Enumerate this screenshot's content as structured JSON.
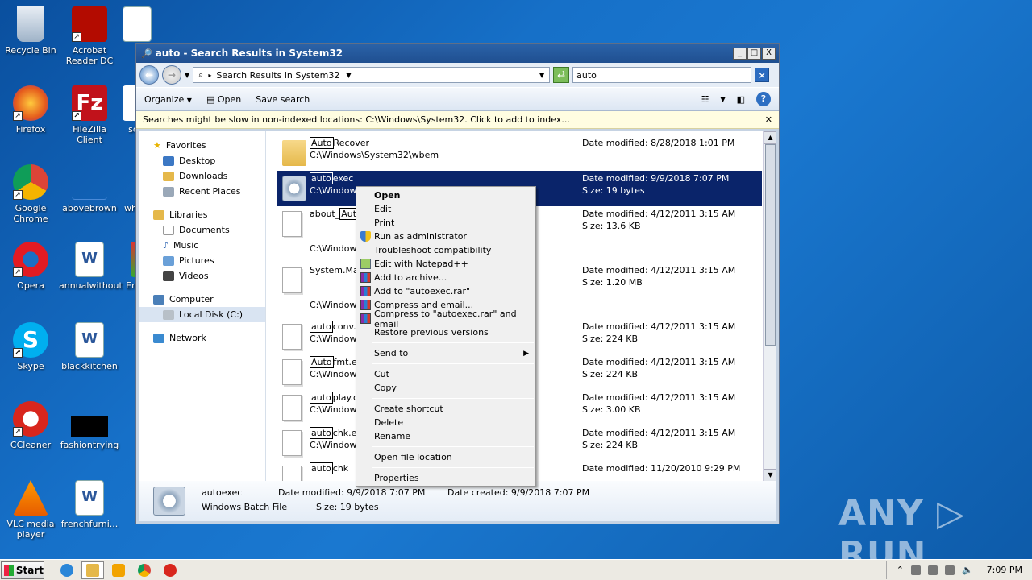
{
  "desktop": {
    "icons": [
      {
        "label": "Recycle Bin"
      },
      {
        "label": "Acrobat Reader DC"
      },
      {
        "label": "Firefox"
      },
      {
        "label": "FileZilla Client"
      },
      {
        "label": "Google Chrome"
      },
      {
        "label": "abovebrown"
      },
      {
        "label": "Opera"
      },
      {
        "label": "annualwithout"
      },
      {
        "label": "Skype"
      },
      {
        "label": "blackkitchen"
      },
      {
        "label": "CCleaner"
      },
      {
        "label": "fashiontrying"
      },
      {
        "label": "VLC media player"
      },
      {
        "label": "frenchfurni..."
      }
    ],
    "partial_labels": [
      "s",
      "sc",
      "wh",
      "Em"
    ]
  },
  "window": {
    "title": "auto - Search Results in System32",
    "controls": {
      "minimize": "_",
      "maximize": "□",
      "close": "X"
    },
    "address": "Search Results in System32",
    "search_value": "auto",
    "toolbar": {
      "organize": "Organize",
      "open": "Open",
      "save_search": "Save search"
    },
    "infobar": "Searches might be slow in non-indexed locations: C:\\Windows\\System32. Click to add to index...",
    "nav": {
      "favorites": "Favorites",
      "desktop": "Desktop",
      "downloads": "Downloads",
      "recent": "Recent Places",
      "libraries": "Libraries",
      "documents": "Documents",
      "music": "Music",
      "pictures": "Pictures",
      "videos": "Videos",
      "computer": "Computer",
      "local_disk": "Local Disk (C:)",
      "network": "Network"
    },
    "results": [
      {
        "pre": "",
        "hl": "Auto",
        "post": "Recover",
        "path": "C:\\Windows\\System32\\wbem",
        "date": "Date modified: 8/28/2018 1:01 PM",
        "size": ""
      },
      {
        "pre": "",
        "hl": "auto",
        "post": "exec",
        "path": "C:\\Window",
        "date": "Date modified: 9/9/2018 7:07 PM",
        "size": "Size: 19 bytes"
      },
      {
        "pre": "about_",
        "hl": "Auto",
        "post": "",
        "path": "C:\\Window",
        "date": "Date modified: 4/12/2011 3:15 AM",
        "size": "Size: 13.6 KB"
      },
      {
        "pre": "System.Ma",
        "hl": "",
        "post": "",
        "path": "C:\\Window",
        "date": "Date modified: 4/12/2011 3:15 AM",
        "size": "Size: 1.20 MB"
      },
      {
        "pre": "",
        "hl": "auto",
        "post": "conv.e",
        "path": "C:\\Window",
        "date": "Date modified: 4/12/2011 3:15 AM",
        "size": "Size: 224 KB"
      },
      {
        "pre": "",
        "hl": "Auto",
        "post": "fmt.ex",
        "path": "C:\\Window",
        "date": "Date modified: 4/12/2011 3:15 AM",
        "size": "Size: 224 KB"
      },
      {
        "pre": "",
        "hl": "auto",
        "post": "play.d",
        "path": "C:\\Window",
        "date": "Date modified: 4/12/2011 3:15 AM",
        "size": "Size: 3.00 KB"
      },
      {
        "pre": "",
        "hl": "auto",
        "post": "chk.ex",
        "path": "C:\\Window",
        "date": "Date modified: 4/12/2011 3:15 AM",
        "size": "Size: 224 KB"
      },
      {
        "pre": "",
        "hl": "auto",
        "post": "chk",
        "path": "",
        "date": "Date modified: 11/20/2010 9:29 PM",
        "size": ""
      }
    ],
    "details": {
      "name": "autoexec",
      "type": "Windows Batch File",
      "modified": "Date modified: 9/9/2018 7:07 PM",
      "size": "Size: 19 bytes",
      "created": "Date created: 9/9/2018 7:07 PM"
    }
  },
  "context_menu": {
    "open": "Open",
    "edit": "Edit",
    "print": "Print",
    "run_admin": "Run as administrator",
    "troubleshoot": "Troubleshoot compatibility",
    "notepadpp": "Edit with Notepad++",
    "add_archive": "Add to archive...",
    "add_rar": "Add to \"autoexec.rar\"",
    "compress_email": "Compress and email...",
    "compress_rar_email": "Compress to \"autoexec.rar\" and email",
    "restore": "Restore previous versions",
    "send_to": "Send to",
    "cut": "Cut",
    "copy": "Copy",
    "create_shortcut": "Create shortcut",
    "delete": "Delete",
    "rename": "Rename",
    "open_location": "Open file location",
    "properties": "Properties"
  },
  "taskbar": {
    "start": "Start",
    "clock": "7:09 PM"
  },
  "watermark": "ANY ▷ RUN"
}
